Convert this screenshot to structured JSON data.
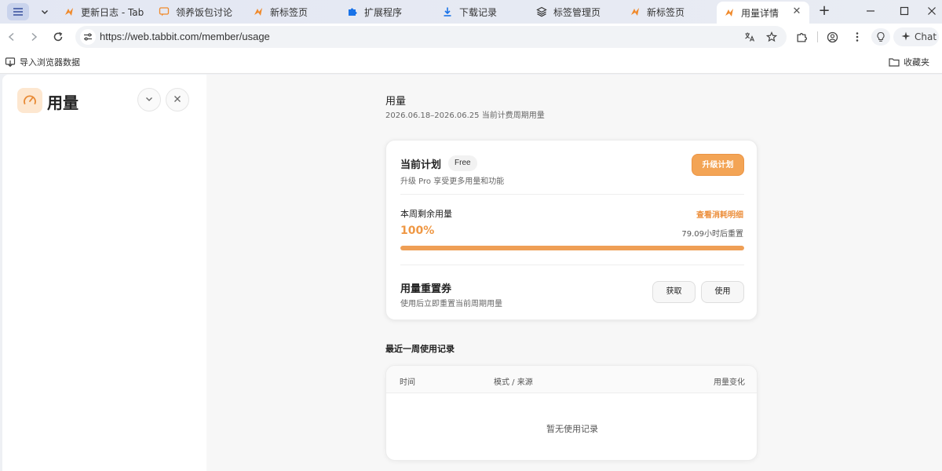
{
  "browser": {
    "tabs": [
      {
        "label": "更新日志 - Tabbit",
        "icon": "tabbit-logo-icon"
      },
      {
        "label": "领养饭包讨论",
        "icon": "chat-bubble-icon"
      },
      {
        "label": "新标签页",
        "icon": "tabbit-logo-icon"
      },
      {
        "label": "扩展程序",
        "icon": "puzzle-icon"
      },
      {
        "label": "下载记录",
        "icon": "download-icon"
      },
      {
        "label": "标签管理页",
        "icon": "layers-icon"
      },
      {
        "label": "新标签页",
        "icon": "tabbit-logo-icon"
      },
      {
        "label": "用量详情",
        "icon": "tabbit-logo-icon",
        "active": true
      }
    ],
    "url": "https://web.tabbit.com/member/usage",
    "chat_label": "Chat",
    "bookmarks": {
      "import_label": "导入浏览器数据",
      "favorites_label": "收藏夹"
    },
    "accent": "#f08a2c"
  },
  "sidebar": {
    "title": "用量"
  },
  "usage": {
    "title": "用量",
    "period": "2026.06.18–2026.06.25 当前计费周期用量",
    "plan": {
      "label": "当前计划",
      "badge": "Free",
      "desc": "升级 Pro 享受更多用量和功能",
      "upgrade_label": "升级计划"
    },
    "remaining": {
      "label": "本周剩余用量",
      "detail_link": "查看消耗明细",
      "percent_text": "100%",
      "fraction": 1.0,
      "reset_text": "79.09小时后重置"
    },
    "coupon": {
      "label": "用量重置券",
      "desc": "使用后立即重置当前周期用量",
      "get_label": "获取",
      "use_label": "使用"
    },
    "records": {
      "title": "最近一周使用记录",
      "columns": [
        "时间",
        "模式 / 来源",
        "用量变化"
      ],
      "empty_text": "暂无使用记录"
    },
    "colors": {
      "primary": "#f3a455",
      "progress": "#ef9f55"
    }
  }
}
